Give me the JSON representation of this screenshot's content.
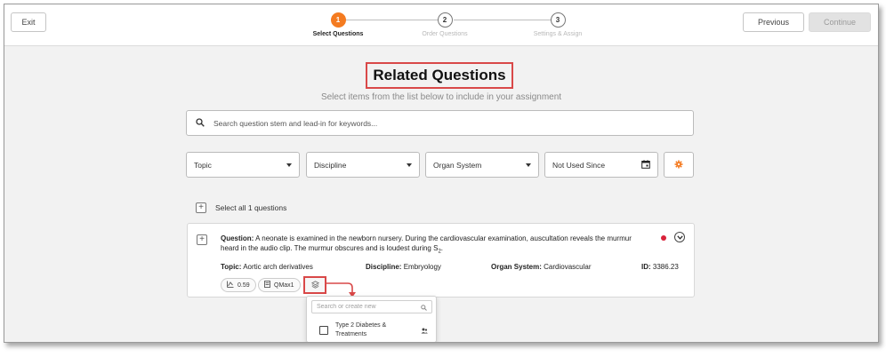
{
  "header": {
    "exit_label": "Exit",
    "previous_label": "Previous",
    "continue_label": "Continue",
    "steps": [
      {
        "num": "1",
        "label": "Select Questions"
      },
      {
        "num": "2",
        "label": "Order Questions"
      },
      {
        "num": "3",
        "label": "Settings & Assign"
      }
    ],
    "active_step": 1
  },
  "main": {
    "title": "Related Questions",
    "subtitle": "Select items from the list below to include in your assignment",
    "search_placeholder": "Search question stem and lead-in for keywords...",
    "filters": {
      "topic": "Topic",
      "discipline": "Discipline",
      "organ_system": "Organ System",
      "not_used_since": "Not Used Since"
    },
    "select_all_label": "Select all 1 questions"
  },
  "question": {
    "question_label": "Question:",
    "question_text_1": "A neonate is examined in the newborn nursery. During the cardiovascular examination, auscultation reveals the murmur heard in the audio clip. The murmur obscures and is loudest during S",
    "question_subscript": "2",
    "question_text_end": ".",
    "topic_label": "Topic:",
    "topic_value": "Aortic arch derivatives",
    "discipline_label": "Discipline:",
    "discipline_value": "Embryology",
    "organ_label": "Organ System:",
    "organ_value": "Cardiovascular",
    "id_label": "ID:",
    "id_value": "3386.23",
    "stat_value": "0.59",
    "qmax_label": "QMax1"
  },
  "popover": {
    "search_placeholder": "Search or create new",
    "items": [
      {
        "label": "Type 2 Diabetes & Treatments",
        "checked": false
      }
    ]
  },
  "colors": {
    "accent": "#f47b20",
    "highlight": "#d94848",
    "status_dot": "#d9223a"
  }
}
